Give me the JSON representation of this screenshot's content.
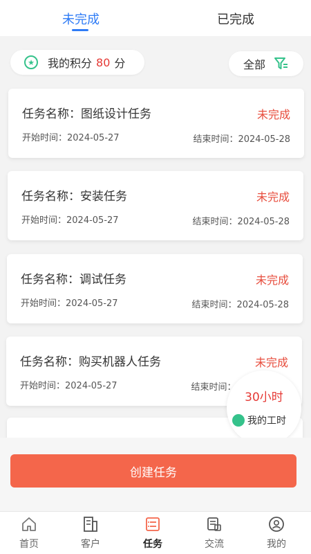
{
  "tabs": [
    {
      "label": "未完成",
      "active": true
    },
    {
      "label": "已完成",
      "active": false
    }
  ],
  "points": {
    "label": "我的积分",
    "value": "80",
    "unit": "分"
  },
  "filter": {
    "label": "全部"
  },
  "tasks": [
    {
      "name": "任务名称：图纸设计任务",
      "status": "未完成",
      "start": "开始时间：2024-05-27",
      "end": "结束时间：2024-05-28"
    },
    {
      "name": "任务名称：安装任务",
      "status": "未完成",
      "start": "开始时间：2024-05-27",
      "end": "结束时间：2024-05-28"
    },
    {
      "name": "任务名称：调试任务",
      "status": "未完成",
      "start": "开始时间：2024-05-27",
      "end": "结束时间：2024-05-28"
    },
    {
      "name": "任务名称：购买机器人任务",
      "status": "未完成",
      "start": "开始时间：2024-05-27",
      "end": "结束时间：2024-05-28"
    }
  ],
  "work_hours": {
    "value": "30小时",
    "label": "我的工时"
  },
  "create_button": "创建任务",
  "tabbar": [
    {
      "label": "首页",
      "icon": "home-icon"
    },
    {
      "label": "客户",
      "icon": "customer-icon"
    },
    {
      "label": "任务",
      "icon": "task-icon",
      "active": true
    },
    {
      "label": "交流",
      "icon": "chat-icon"
    },
    {
      "label": "我的",
      "icon": "profile-icon"
    }
  ],
  "colors": {
    "accent": "#2f7cf6",
    "danger": "#e53935",
    "button": "#f4664b",
    "green": "#35c28b"
  }
}
